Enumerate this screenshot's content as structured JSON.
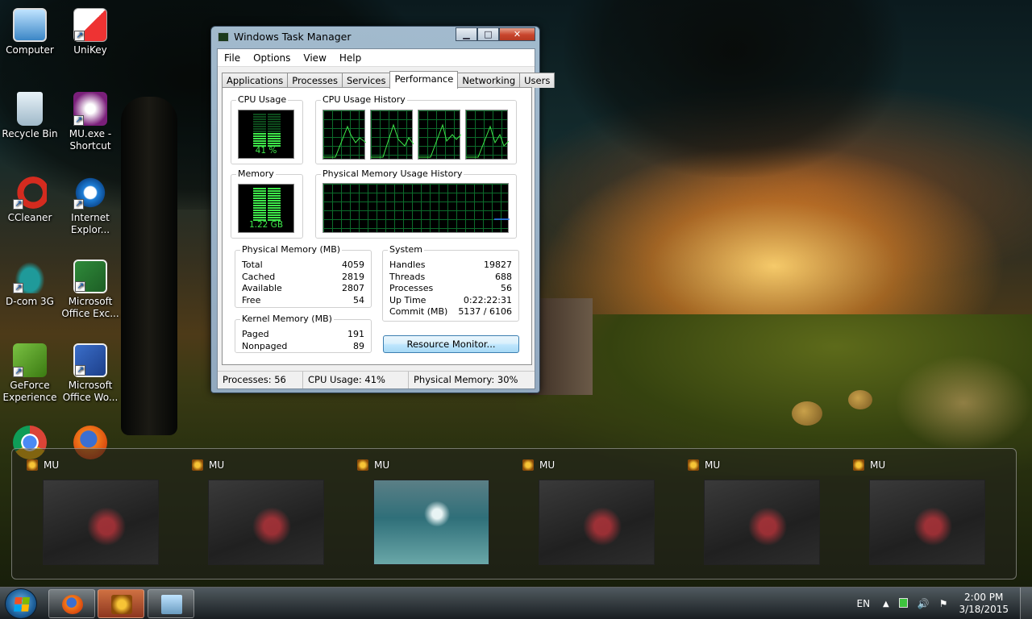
{
  "desktop": {
    "icons": [
      {
        "label": "Computer"
      },
      {
        "label": "UniKey"
      },
      {
        "label": "Recycle Bin"
      },
      {
        "label": "MU.exe - Shortcut"
      },
      {
        "label": "CCleaner"
      },
      {
        "label": "Internet Explor..."
      },
      {
        "label": "D-com 3G"
      },
      {
        "label": "Microsoft Office Exc..."
      },
      {
        "label": "GeForce Experience"
      },
      {
        "label": "Microsoft Office Wo..."
      }
    ]
  },
  "task_manager": {
    "title": "Windows Task Manager",
    "menu": [
      "File",
      "Options",
      "View",
      "Help"
    ],
    "tabs": [
      "Applications",
      "Processes",
      "Services",
      "Performance",
      "Networking",
      "Users"
    ],
    "active_tab": "Performance",
    "cpu_usage": {
      "title": "CPU Usage",
      "value": "41 %",
      "percent": 41
    },
    "cpu_history": {
      "title": "CPU Usage History",
      "cores": 4
    },
    "memory": {
      "title": "Memory",
      "value": "1.22 GB"
    },
    "memory_history": {
      "title": "Physical Memory Usage History"
    },
    "physical_memory": {
      "title": "Physical Memory (MB)",
      "rows": [
        {
          "label": "Total",
          "value": "4059"
        },
        {
          "label": "Cached",
          "value": "2819"
        },
        {
          "label": "Available",
          "value": "2807"
        },
        {
          "label": "Free",
          "value": "54"
        }
      ]
    },
    "kernel_memory": {
      "title": "Kernel Memory (MB)",
      "rows": [
        {
          "label": "Paged",
          "value": "191"
        },
        {
          "label": "Nonpaged",
          "value": "89"
        }
      ]
    },
    "system": {
      "title": "System",
      "rows": [
        {
          "label": "Handles",
          "value": "19827"
        },
        {
          "label": "Threads",
          "value": "688"
        },
        {
          "label": "Processes",
          "value": "56"
        },
        {
          "label": "Up Time",
          "value": "0:22:22:31"
        },
        {
          "label": "Commit (MB)",
          "value": "5137 / 6106"
        }
      ]
    },
    "resource_monitor_button": "Resource Monitor...",
    "status": {
      "processes": "Processes: 56",
      "cpu": "CPU Usage: 41%",
      "memory": "Physical Memory: 30%"
    }
  },
  "thumbnails": {
    "items": [
      {
        "title": "MU"
      },
      {
        "title": "MU"
      },
      {
        "title": "MU"
      },
      {
        "title": "MU"
      },
      {
        "title": "MU"
      },
      {
        "title": "MU"
      }
    ]
  },
  "taskbar": {
    "language": "EN",
    "time": "2:00 PM",
    "date": "3/18/2015"
  },
  "colors": {
    "meter_green": "#3ee84a",
    "graph_grid": "#0c6b2b",
    "close_red": "#c8452c"
  }
}
